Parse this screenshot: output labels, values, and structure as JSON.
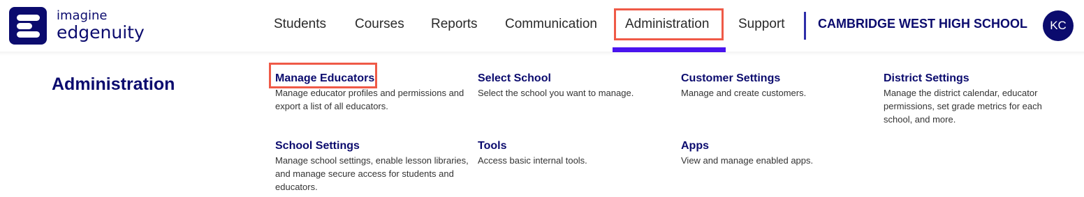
{
  "brand": {
    "line1": "imagine",
    "line2": "edgenuity",
    "color": "#0b0b6e"
  },
  "nav": {
    "students": "Students",
    "courses": "Courses",
    "reports": "Reports",
    "communication": "Communication",
    "administration": "Administration",
    "support": "Support",
    "active_item": "Administration",
    "active_color": "#4a14f0"
  },
  "school": {
    "name": "CAMBRIDGE WEST HIGH SCHOOL"
  },
  "user": {
    "initials": "KC"
  },
  "highlight_color": "#ef5a47",
  "panel": {
    "title": "Administration",
    "items": [
      {
        "title": "Manage Educators",
        "description": "Manage educator profiles and permissions and export a list of all educators."
      },
      {
        "title": "Select School",
        "description": "Select the school you want to manage."
      },
      {
        "title": "Customer Settings",
        "description": "Manage and create customers."
      },
      {
        "title": "District Settings",
        "description": "Manage the district calendar, educator permissions, set grade metrics for each school, and more."
      },
      {
        "title": "School Settings",
        "description": "Manage school settings, enable lesson libraries, and manage secure access for students and educators."
      },
      {
        "title": "Tools",
        "description": "Access basic internal tools."
      },
      {
        "title": "Apps",
        "description": "View and manage enabled apps."
      }
    ]
  }
}
